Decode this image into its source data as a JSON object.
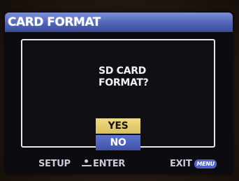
{
  "header": {
    "title": "CARD FORMAT"
  },
  "dialog": {
    "prompt_line1": "SD CARD",
    "prompt_line2": "FORMAT?",
    "options": [
      {
        "label": "YES",
        "selected": true
      },
      {
        "label": "NO",
        "selected": false
      }
    ]
  },
  "footer": {
    "setup_label": "SETUP",
    "enter_label": "ENTER",
    "exit_label": "EXIT",
    "menu_badge": "MENU",
    "enter_icon": "dpad-icon"
  },
  "colors": {
    "title_bar": "#4f63b6",
    "selected_option": "#d8bf5c",
    "unselected_option": "#3e52a8",
    "screen_background": "#0b0b10"
  }
}
